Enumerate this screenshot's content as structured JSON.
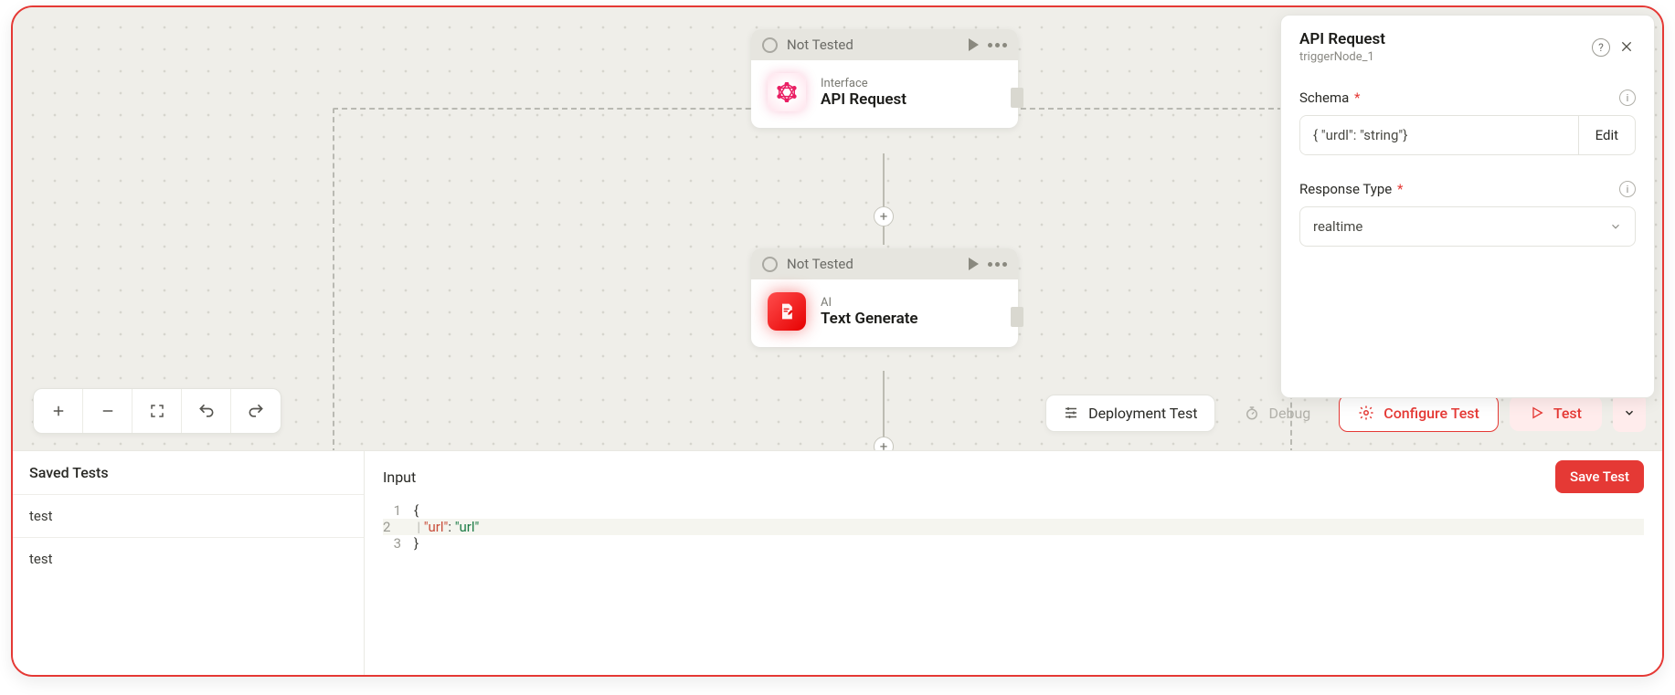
{
  "canvas": {
    "nodes": [
      {
        "status": "Not Tested",
        "category": "Interface",
        "title": "API Request"
      },
      {
        "status": "Not Tested",
        "category": "AI",
        "title": "Text Generate"
      }
    ]
  },
  "toolbarRight": {
    "deployment": "Deployment Test",
    "debug": "Debug",
    "configure": "Configure Test",
    "test": "Test"
  },
  "sidePanel": {
    "title": "API Request",
    "subtitle": "triggerNode_1",
    "schemaLabel": "Schema",
    "schemaValue": "{ \"urdl\": \"string\"}",
    "editLabel": "Edit",
    "responseTypeLabel": "Response Type",
    "responseTypeValue": "realtime"
  },
  "bottom": {
    "savedHeader": "Saved Tests",
    "savedItems": [
      "test",
      "test"
    ],
    "inputLabel": "Input",
    "saveTest": "Save Test",
    "code": {
      "line1": "{",
      "line2_key": "\"url\"",
      "line2_val": "\"url\"",
      "line3": "}"
    }
  }
}
